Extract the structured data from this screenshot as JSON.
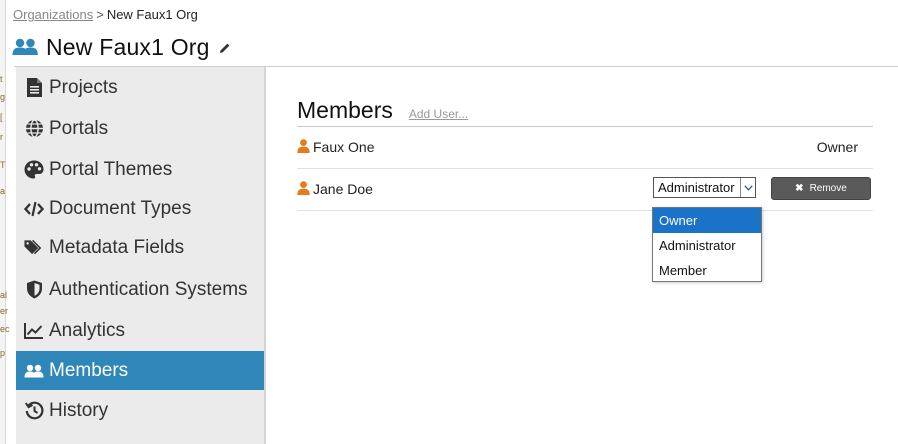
{
  "breadcrumb": {
    "link": "Organizations",
    "separator": ">",
    "current": "New Faux1 Org"
  },
  "page": {
    "title": "New Faux1 Org",
    "title_icon": "users-icon",
    "edit_icon": "pencil-icon"
  },
  "sidebar": {
    "active_color": "#2e87b8",
    "items": [
      {
        "label": "Projects",
        "icon": "file-icon"
      },
      {
        "label": "Portals",
        "icon": "globe-icon"
      },
      {
        "label": "Portal Themes",
        "icon": "palette-icon"
      },
      {
        "label": "Document Types",
        "icon": "code-icon"
      },
      {
        "label": "Metadata Fields",
        "icon": "tags-icon"
      },
      {
        "label": "Authentication Systems",
        "icon": "shield-icon"
      },
      {
        "label": "Analytics",
        "icon": "chart-line-icon"
      },
      {
        "label": "Members",
        "icon": "users-icon",
        "active": true
      },
      {
        "label": "History",
        "icon": "history-icon"
      }
    ]
  },
  "members": {
    "heading": "Members",
    "add_user_label": "Add User...",
    "rows": [
      {
        "name": "Faux One",
        "role": "Owner"
      },
      {
        "name": "Jane Doe",
        "role": "Administrator"
      }
    ],
    "remove_label": "Remove",
    "person_icon_color": "#e87a1e"
  },
  "role_dropdown": {
    "selected": "Administrator",
    "options": [
      "Owner",
      "Administrator",
      "Member"
    ],
    "highlighted": "Owner",
    "highlight_color": "#1a73c8"
  }
}
